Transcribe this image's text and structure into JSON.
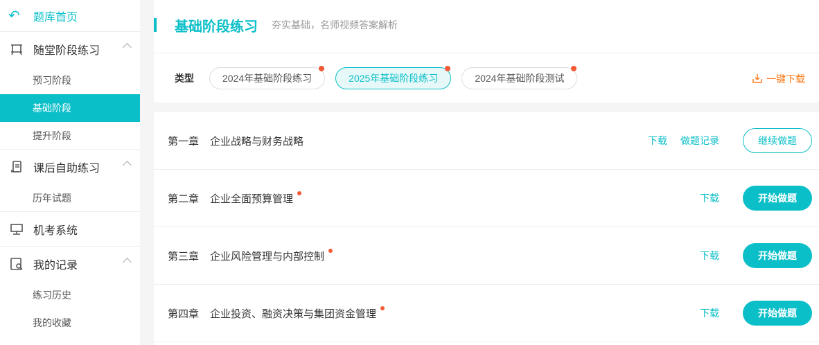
{
  "sidebar": {
    "home": "题库首页",
    "groups": [
      {
        "label": "随堂阶段练习",
        "items": [
          "预习阶段",
          "基础阶段",
          "提升阶段"
        ]
      },
      {
        "label": "课后自助练习",
        "items": [
          "历年试题"
        ]
      },
      {
        "label": "机考系统"
      },
      {
        "label": "我的记录",
        "items": [
          "练习历史",
          "我的收藏"
        ]
      }
    ]
  },
  "header": {
    "title": "基础阶段练习",
    "subtitle": "夯实基础，名师视频答案解析",
    "type_label": "类型",
    "types": [
      "2024年基础阶段练习",
      "2025年基础阶段练习",
      "2024年基础阶段测试"
    ],
    "download_all": "一键下载"
  },
  "chapters": [
    {
      "chapter": "第一章",
      "name": "企业战略与财务战略",
      "download": "下载",
      "record": "做题记录",
      "action": "继续做题"
    },
    {
      "chapter": "第二章",
      "name": "企业全面预算管理",
      "download": "下载",
      "action": "开始做题"
    },
    {
      "chapter": "第三章",
      "name": "企业风险管理与内部控制",
      "download": "下载",
      "action": "开始做题"
    },
    {
      "chapter": "第四章",
      "name": "企业投资、融资决策与集团资金管理",
      "download": "下载",
      "action": "开始做题"
    }
  ],
  "colors": {
    "accent": "#0abfc8",
    "orange": "#ff7a1a",
    "dot": "#f25a35"
  }
}
